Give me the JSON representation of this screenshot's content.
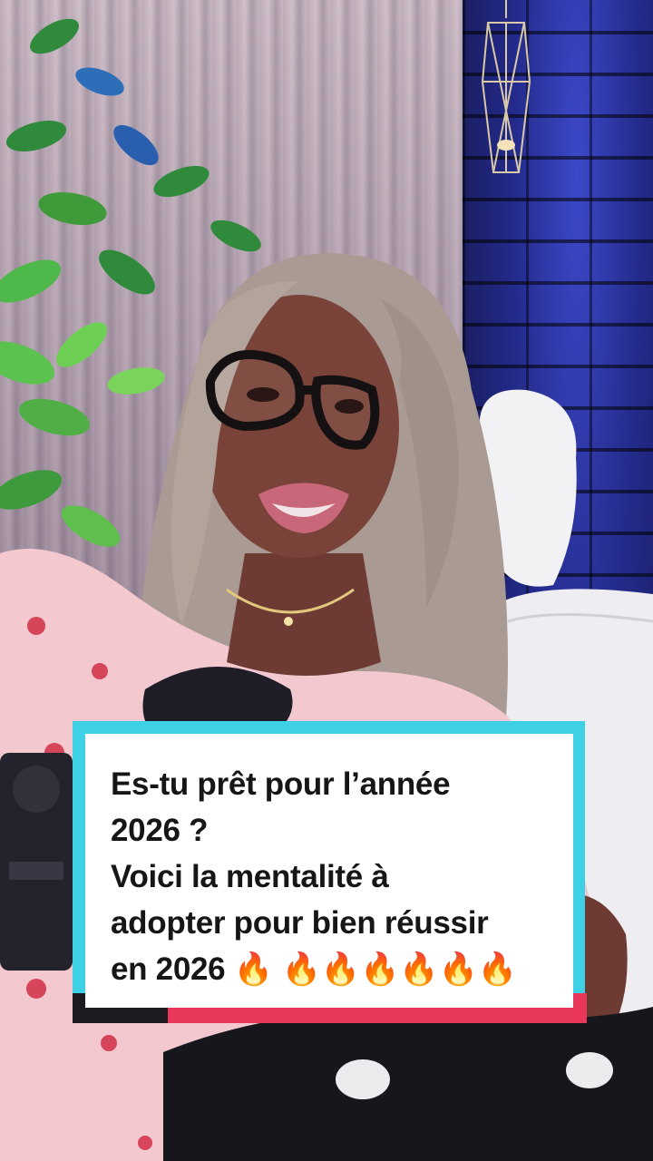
{
  "caption": {
    "lines": [
      "Es-tu prêt pour l’année",
      "2026 ?",
      "Voici la mentalité à",
      "adopter pour bien réussir",
      "en 2026 🔥 🔥🔥🔥🔥🔥🔥"
    ]
  },
  "colors": {
    "caption_cyan": "#3ed1e6",
    "caption_red": "#e8375a",
    "caption_dark": "#1d1a22",
    "caption_bg": "#ffffff",
    "caption_text": "#161616",
    "brick_wall_blue": "#232a8a"
  },
  "scene": {
    "elements": [
      "slat-wall",
      "blue-brick-wall",
      "geometric-lantern",
      "plant",
      "white-chair",
      "person-with-glasses",
      "microphone",
      "dark-fabric"
    ]
  }
}
